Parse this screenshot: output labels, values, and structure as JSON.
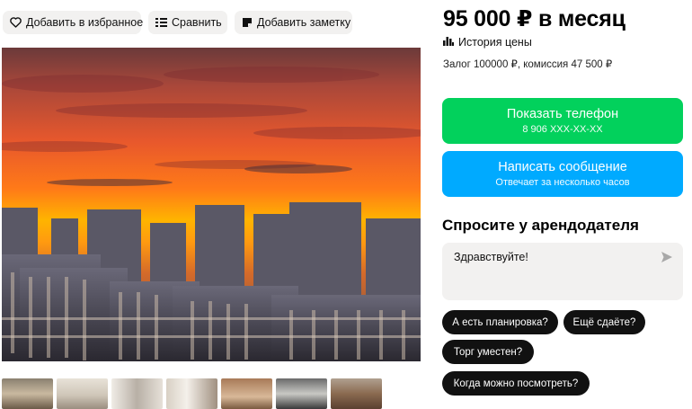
{
  "actions": {
    "favorite_label": "Добавить в избранное",
    "compare_label": "Сравнить",
    "note_label": "Добавить заметку"
  },
  "listing": {
    "price": "95 000 ₽ в месяц",
    "price_history_label": "История цены",
    "deposit_text": "Залог 100000 ₽, комиссия 47 500 ₽"
  },
  "contact": {
    "phone_button_label": "Показать телефон",
    "phone_masked": "8 906 XXX-XX-XX",
    "message_button_label": "Написать сообщение",
    "message_button_sub": "Отвечает за несколько часов"
  },
  "ask": {
    "title": "Спросите у арендодателя",
    "message_text": "Здравствуйте!",
    "quick_questions": [
      "А есть планировка?",
      "Ещё сдаёте?",
      "Торг уместен?",
      "Когда можно посмотреть?"
    ]
  },
  "colors": {
    "phone_button": "#02d15c",
    "message_button": "#00aaff",
    "chip_bg": "#f2f1f0",
    "question_chip": "#111111"
  },
  "icons": {
    "favorite": "heart-icon",
    "compare": "compare-icon",
    "note": "note-icon",
    "history": "bar-chart-icon",
    "send": "send-arrow-icon"
  }
}
